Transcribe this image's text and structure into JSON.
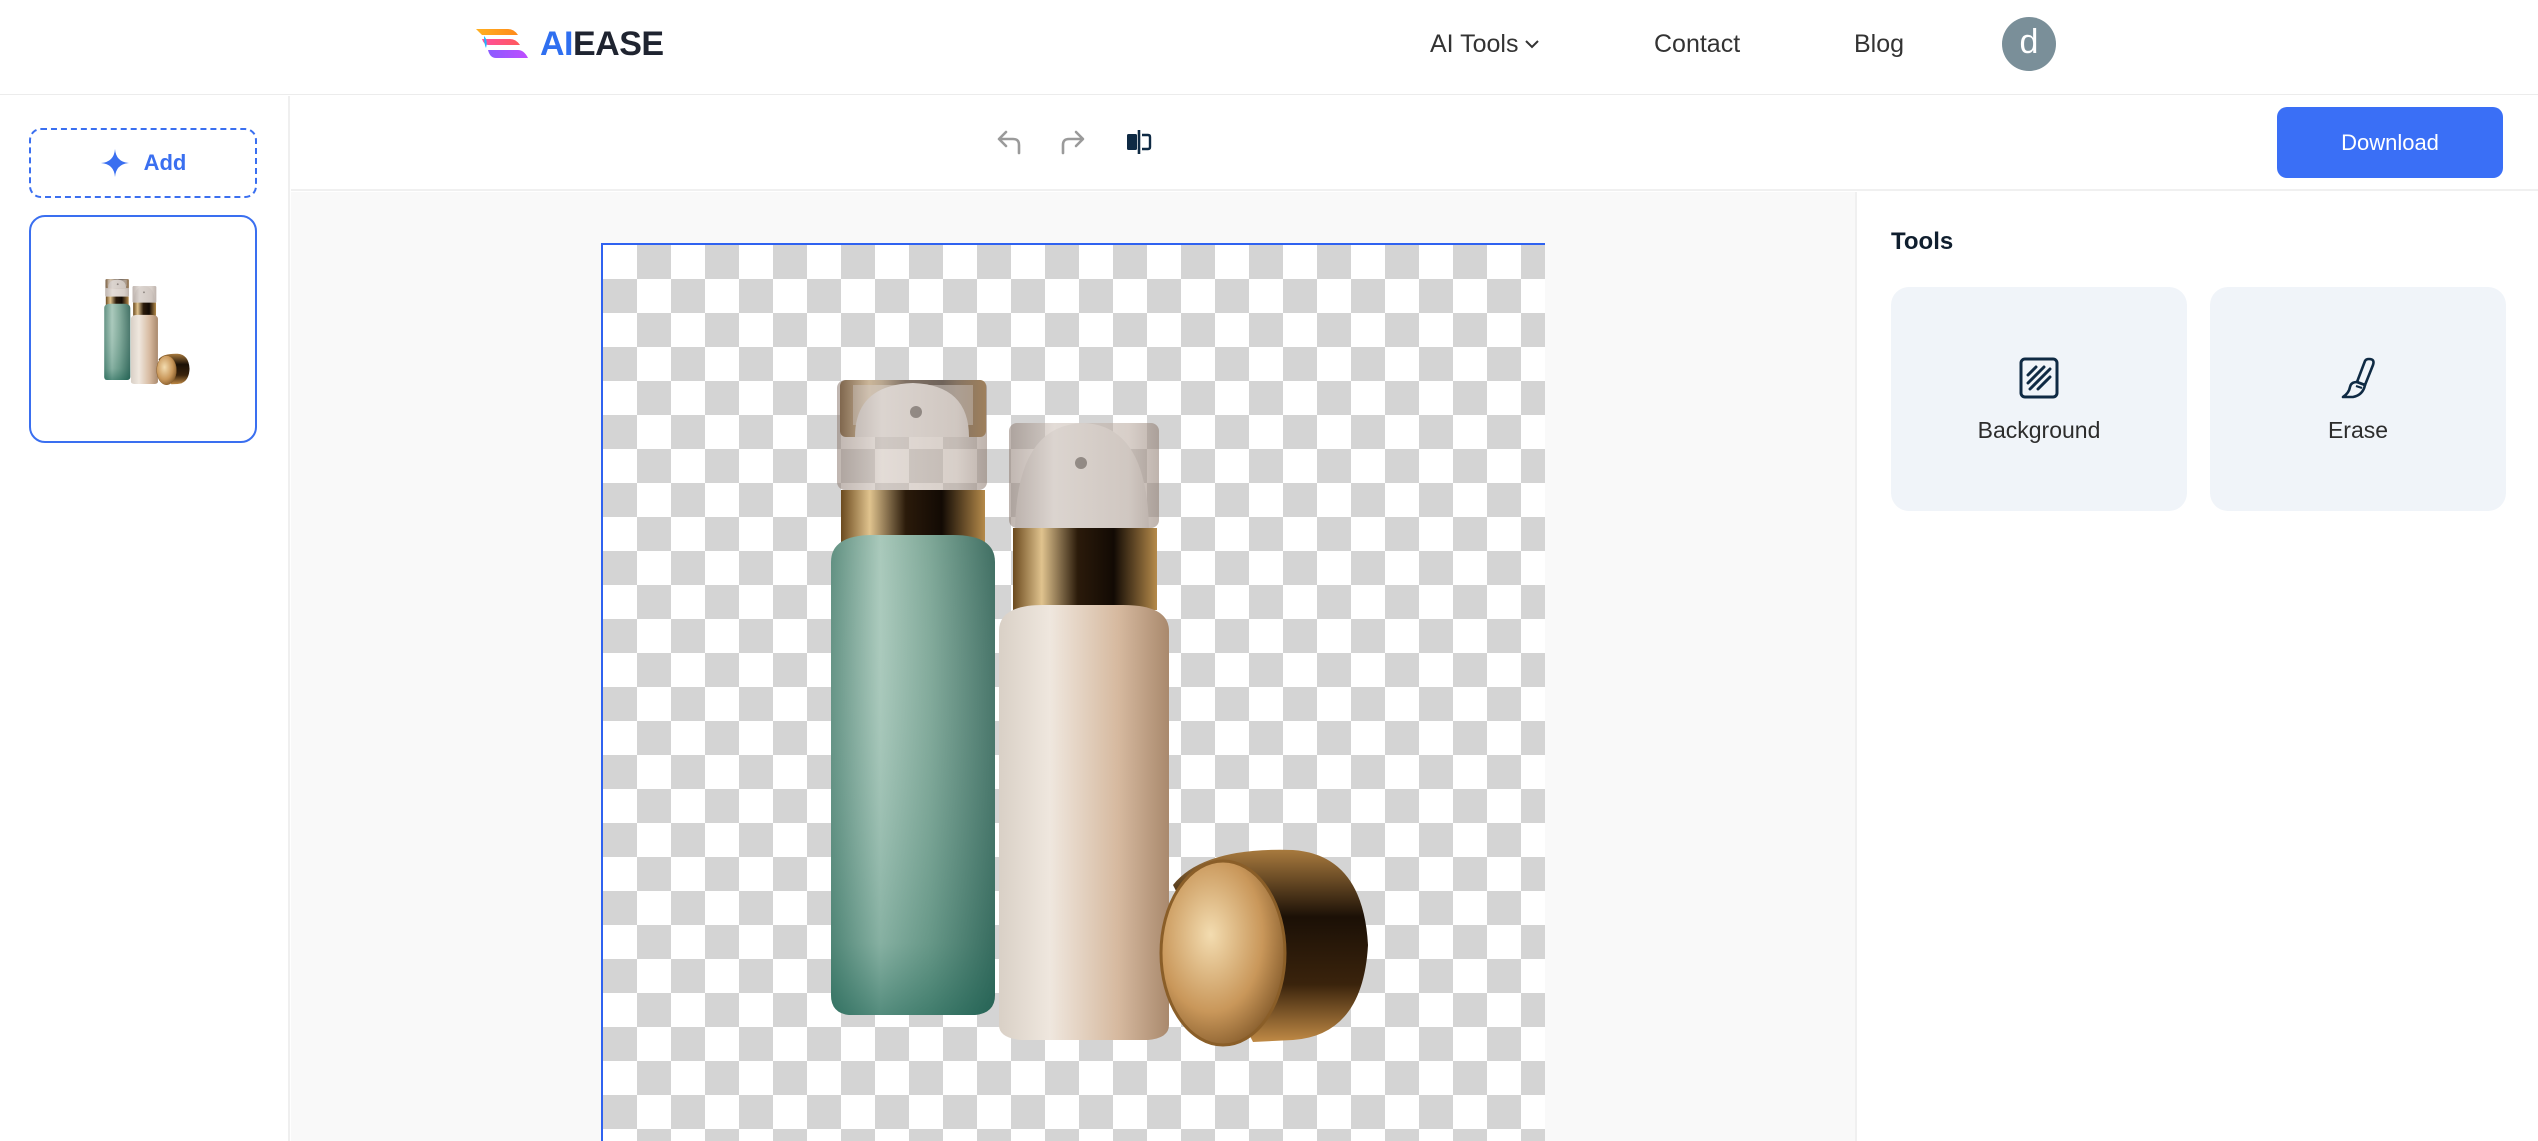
{
  "header": {
    "logo": {
      "part1": "AI",
      "part2": "EASE"
    },
    "nav": [
      {
        "label": "AI Tools",
        "has_dropdown": true
      },
      {
        "label": "Contact"
      },
      {
        "label": "Blog"
      }
    ],
    "avatar_initial": "d"
  },
  "sidebar": {
    "add_label": "Add",
    "thumbnails": [
      {
        "selected": true,
        "description": "cosmetic bottles"
      }
    ]
  },
  "toolbar": {
    "icons": [
      "undo-icon",
      "redo-icon",
      "compare-icon"
    ],
    "download_label": "Download"
  },
  "tools_panel": {
    "title": "Tools",
    "items": [
      {
        "label": "Background",
        "icon": "background-icon"
      },
      {
        "label": "Erase",
        "icon": "brush-icon"
      }
    ]
  },
  "colors": {
    "accent": "#3a6ff6",
    "avatar": "#7a8f99",
    "tool_card": "#f0f4f9",
    "checker": "#d4d4d4"
  }
}
